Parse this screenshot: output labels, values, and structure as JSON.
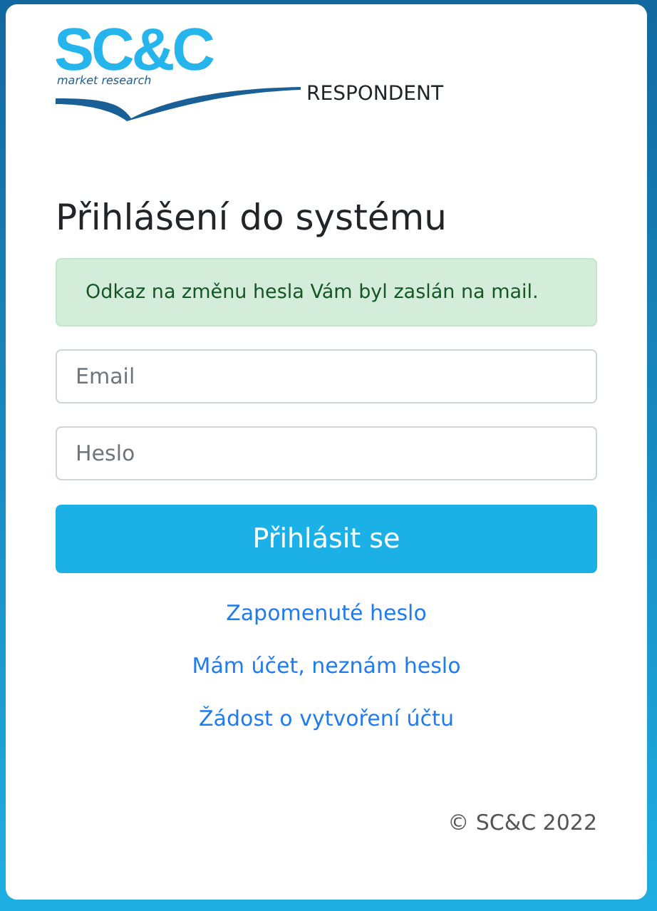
{
  "logo": {
    "name": "SC&C",
    "tagline": "market research"
  },
  "app_label": "RESPONDENT",
  "title": "Přihlášení do systému",
  "alert": "Odkaz na změnu hesla Vám byl zaslán na mail.",
  "fields": [
    {
      "placeholder": "Email"
    },
    {
      "placeholder": "Heslo"
    }
  ],
  "submit": "Přihlásit se",
  "links": [
    "Zapomenuté heslo",
    "Mám účet, neznám heslo",
    "Žádost o vytvoření účtu"
  ],
  "footer": "© SC&C 2022"
}
